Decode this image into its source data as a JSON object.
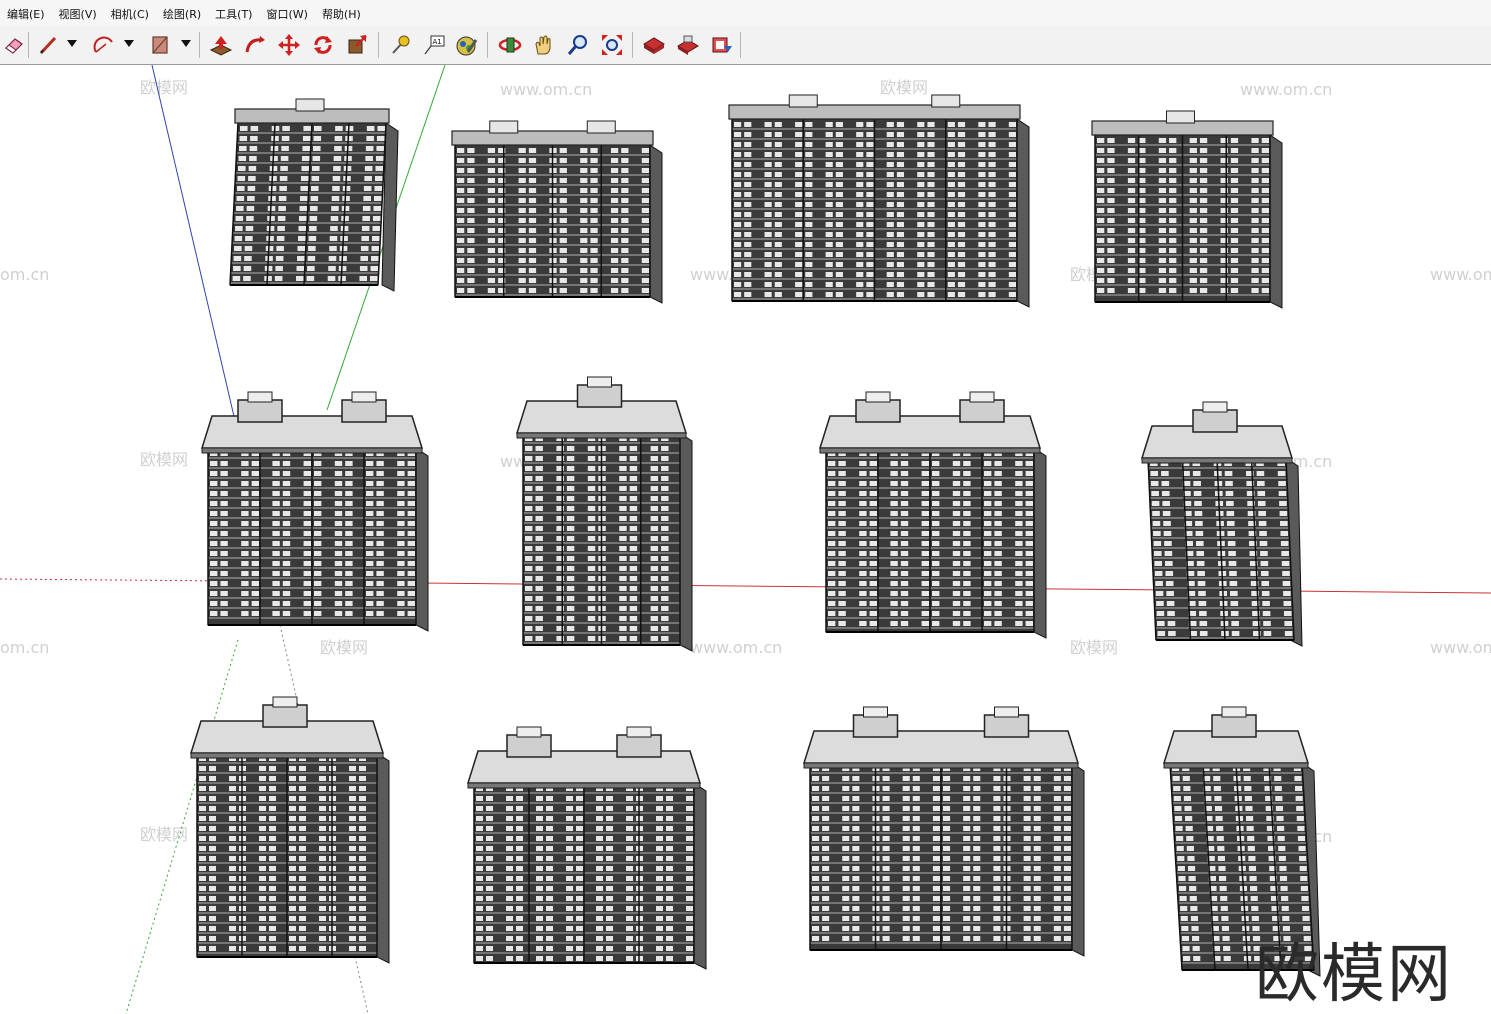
{
  "menu": {
    "items": [
      {
        "label": "编辑(E)"
      },
      {
        "label": "视图(V)"
      },
      {
        "label": "相机(C)"
      },
      {
        "label": "绘图(R)"
      },
      {
        "label": "工具(T)"
      },
      {
        "label": "窗口(W)"
      },
      {
        "label": "帮助(H)"
      }
    ]
  },
  "toolbar": {
    "tools": [
      {
        "icon": "eraser-icon"
      },
      {
        "icon": "pencil-icon"
      },
      {
        "icon": "arc-icon"
      },
      {
        "icon": "rectangle-icon"
      },
      {
        "icon": "push-pull-icon"
      },
      {
        "icon": "follow-me-icon"
      },
      {
        "icon": "move-icon"
      },
      {
        "icon": "rotate-icon"
      },
      {
        "icon": "scale-icon"
      },
      {
        "icon": "tape-measure-icon"
      },
      {
        "icon": "text-icon",
        "text": "A1"
      },
      {
        "icon": "paint-bucket-icon"
      },
      {
        "icon": "orbit-icon"
      },
      {
        "icon": "pan-icon"
      },
      {
        "icon": "zoom-icon"
      },
      {
        "icon": "zoom-extents-icon"
      },
      {
        "icon": "warehouse-icon"
      },
      {
        "icon": "share-model-icon"
      },
      {
        "icon": "extension-warehouse-icon"
      }
    ]
  },
  "viewport": {
    "watermark_url": "www.om.cn",
    "watermark_cn": "欧模网",
    "watermark_url_short": "om.cn",
    "logo_text": "欧模网",
    "axis_colors": {
      "red": "#cc3333",
      "green": "#33aa33",
      "blue": "#3344aa"
    },
    "building_count": 12
  }
}
